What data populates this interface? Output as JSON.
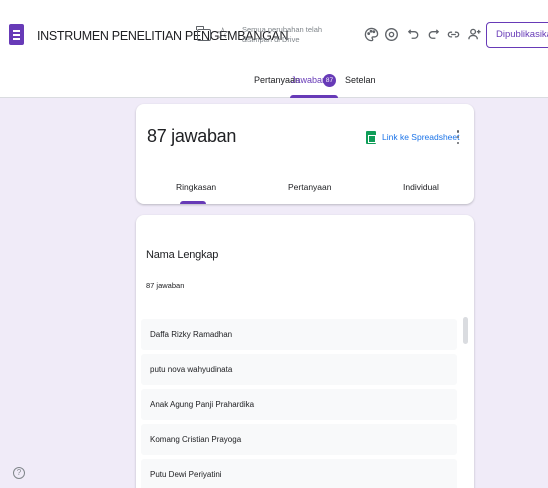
{
  "header": {
    "doc_title": "INSTRUMEN PENELITIAN PENGEMBANGAN",
    "save_status_line1": "Semua perubahan telah",
    "save_status_line2": "disimpan di Drive",
    "publish_label": "Dipublikasikan"
  },
  "tabs": {
    "questions": "Pertanyaan",
    "responses": "Jawaban",
    "responses_badge": "87",
    "settings": "Setelan"
  },
  "summary": {
    "response_count": "87 jawaban",
    "sheet_link": "Link ke Spreadsheet",
    "sub_tabs": {
      "summary": "Ringkasan",
      "question": "Pertanyaan",
      "individual": "Individual"
    }
  },
  "question": {
    "title": "Nama Lengkap",
    "count": "87 jawaban",
    "answers": [
      "Daffa Rizky Ramadhan",
      "putu nova wahyudinata",
      "Anak Agung Panji Prahardika",
      "Komang Cristian Prayoga",
      "Putu Dewi Periyatini"
    ]
  },
  "colors": {
    "accent": "#673ab7",
    "background": "#f0ebf8",
    "sheets_green": "#0f9d58",
    "link_blue": "#1a73e8"
  },
  "icons": [
    "forms-logo-icon",
    "folder-icon",
    "star-icon",
    "palette-icon",
    "preview-icon",
    "undo-icon",
    "redo-icon",
    "link-icon",
    "add-collaborator-icon",
    "sheets-icon",
    "more-vert-icon",
    "help-icon"
  ]
}
